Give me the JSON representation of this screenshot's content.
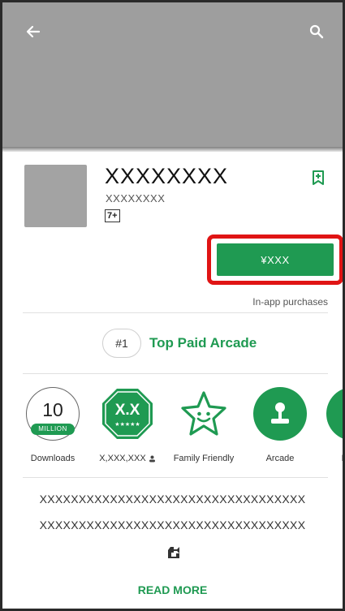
{
  "app": {
    "title": "XXXXXXXX",
    "developer": "XXXXXXXX",
    "content_rating": "7+",
    "price": "¥XXX",
    "in_app_note": "In-app purchases"
  },
  "rank": {
    "number": "#1",
    "label": "Top Paid Arcade"
  },
  "badges": {
    "downloads": {
      "number": "10",
      "unit": "MILLION",
      "label": "Downloads"
    },
    "rating": {
      "value": "X.X",
      "label": "X,XXX,XXX"
    },
    "family": {
      "label": "Family Friendly"
    },
    "arcade": {
      "label": "Arcade"
    },
    "editors": {
      "label": "Editor"
    }
  },
  "description": {
    "line1": "XXXXXXXXXXXXXXXXXXXXXXXXXXXXXXXXXX",
    "line2": "XXXXXXXXXXXXXXXXXXXXXXXXXXXXXXXXXX",
    "read_more": "READ MORE"
  },
  "colors": {
    "accent_green": "#1f9a52",
    "highlight_red": "#e01414",
    "header_gray": "#9e9e9e"
  },
  "icons": {
    "back": "arrow-left-icon",
    "search": "search-icon",
    "wishlist": "bookmark-plus-icon",
    "read_more": "wrench-icon"
  }
}
